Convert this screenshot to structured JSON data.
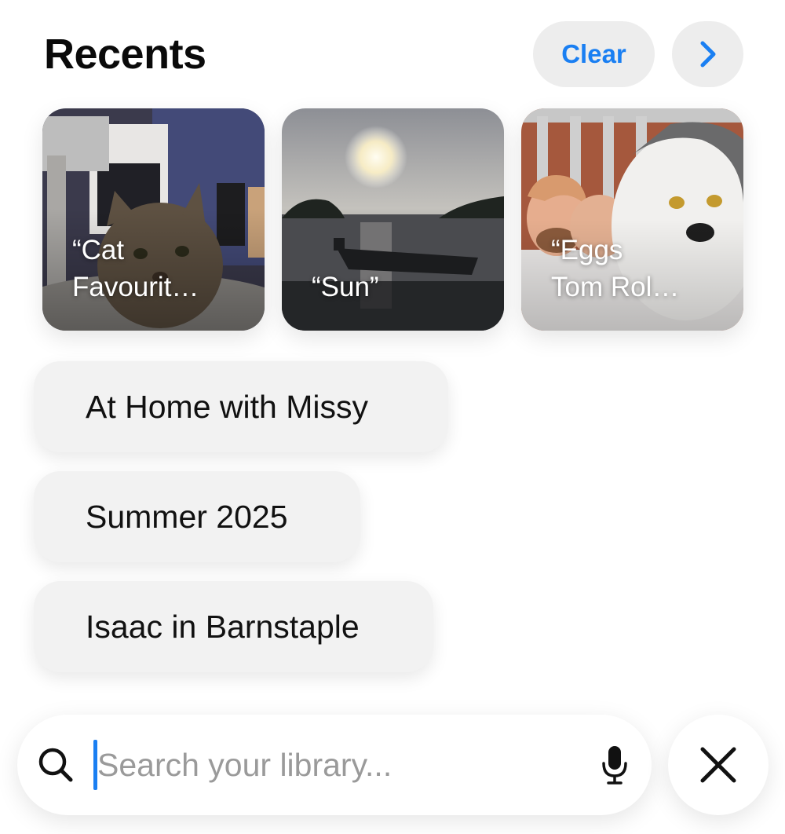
{
  "header": {
    "title": "Recents",
    "clear_label": "Clear",
    "next_icon": "chevron-right-icon",
    "accent_color": "#1a7ff2"
  },
  "recent_cards": [
    {
      "label": "“Cat\nFavourit…",
      "subject": "tabby cat indoors"
    },
    {
      "label": "“Sun”",
      "subject": "sunset over water with boat"
    },
    {
      "label": "“Eggs\nTom Rol…",
      "subject": "man with white cat"
    }
  ],
  "suggestions": [
    {
      "label": "At Home with Missy"
    },
    {
      "label": "Summer 2025"
    },
    {
      "label": "Isaac in Barnstaple"
    }
  ],
  "search": {
    "placeholder": "Search your library...",
    "value": "",
    "search_icon": "search-icon",
    "mic_icon": "microphone-icon",
    "close_icon": "close-icon"
  }
}
